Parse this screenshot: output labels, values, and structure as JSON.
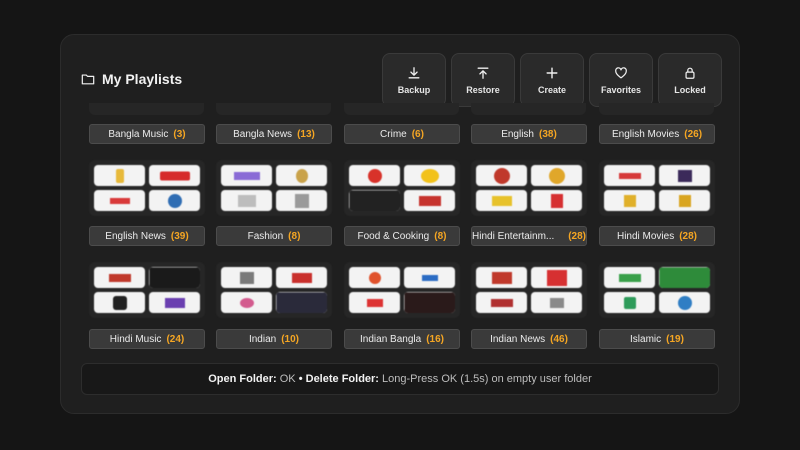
{
  "header": {
    "title": "My Playlists"
  },
  "toolbar": [
    {
      "label": "Backup",
      "icon": "download-icon"
    },
    {
      "label": "Restore",
      "icon": "upload-icon"
    },
    {
      "label": "Create",
      "icon": "plus-icon"
    },
    {
      "label": "Favorites",
      "icon": "heart-icon"
    },
    {
      "label": "Locked",
      "icon": "lock-icon"
    }
  ],
  "folders": [
    {
      "name": "Bangla Music",
      "count": "(3)"
    },
    {
      "name": "Bangla News",
      "count": "(13)"
    },
    {
      "name": "Crime",
      "count": "(6)"
    },
    {
      "name": "English",
      "count": "(38)"
    },
    {
      "name": "English Movies",
      "count": "(26)"
    },
    {
      "name": "English News",
      "count": "(39)"
    },
    {
      "name": "Fashion",
      "count": "(8)"
    },
    {
      "name": "Food & Cooking",
      "count": "(8)"
    },
    {
      "name": "Hindi Entertainm...",
      "count": "(28)"
    },
    {
      "name": "Hindi Movies",
      "count": "(28)"
    },
    {
      "name": "Hindi Music",
      "count": "(24)"
    },
    {
      "name": "Indian",
      "count": "(10)"
    },
    {
      "name": "Indian Bangla",
      "count": "(16)"
    },
    {
      "name": "Indian News",
      "count": "(46)"
    },
    {
      "name": "Islamic",
      "count": "(19)"
    }
  ],
  "footer": {
    "open_label": "Open Folder:",
    "open_value": "OK",
    "separator": "•",
    "delete_label": "Delete Folder:",
    "delete_value": "Long-Press OK (1.5s) on empty user folder"
  },
  "colors": {
    "accent": "#f5a623",
    "panel": "#1f1f1f",
    "button": "#2a2a2a"
  }
}
